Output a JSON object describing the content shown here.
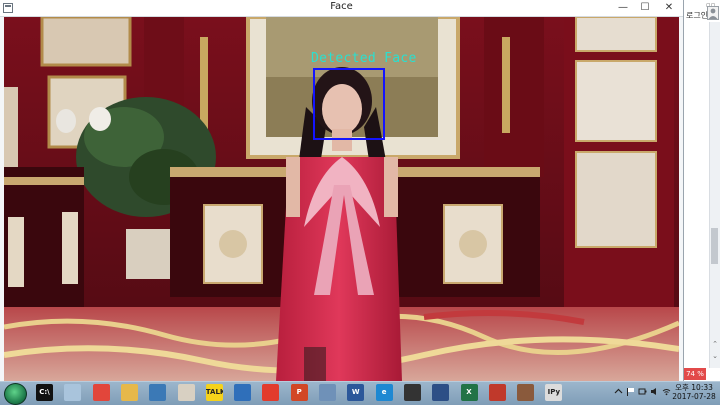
{
  "window": {
    "title": "Face",
    "min_glyph": "—",
    "max_glyph": "☐",
    "close_glyph": "✕"
  },
  "detection": {
    "label": "Detected Face",
    "box_color": "#1414ff",
    "label_color": "#29e0d0"
  },
  "browser_panel": {
    "login_label": "로그인",
    "zoom": "74 %",
    "scroll_up_glyph": "⌃",
    "scroll_down_glyph": "⌄"
  },
  "taskbar": {
    "pinned": [
      {
        "name": "cmd-icon",
        "glyph": "C:\\",
        "color": "#111111"
      },
      {
        "name": "file-icon",
        "glyph": "",
        "color": "#a9c4dc"
      },
      {
        "name": "chrome-icon",
        "glyph": "",
        "color": "#e2463b"
      },
      {
        "name": "explorer-icon",
        "glyph": "",
        "color": "#e6b84a"
      },
      {
        "name": "python-icon",
        "glyph": "",
        "color": "#3b79b6"
      },
      {
        "name": "paint-icon",
        "glyph": "",
        "color": "#d8d0c2"
      },
      {
        "name": "kakaotalk-icon",
        "glyph": "TALK",
        "color": "#f5d21b"
      },
      {
        "name": "hwp-icon",
        "glyph": "",
        "color": "#2f6fba"
      },
      {
        "name": "daum-icon",
        "glyph": "",
        "color": "#e23b2c"
      },
      {
        "name": "powerpoint-icon",
        "glyph": "P",
        "color": "#d24726"
      },
      {
        "name": "document-icon",
        "glyph": "",
        "color": "#6f91b8"
      },
      {
        "name": "word-icon",
        "glyph": "W",
        "color": "#2b579a"
      },
      {
        "name": "internet-explorer-icon",
        "glyph": "e",
        "color": "#1e88d2"
      },
      {
        "name": "media-icon",
        "glyph": "",
        "color": "#333333"
      },
      {
        "name": "settings-icon",
        "glyph": "",
        "color": "#2d4f86"
      },
      {
        "name": "excel-icon",
        "glyph": "X",
        "color": "#217346"
      },
      {
        "name": "matlab-icon",
        "glyph": "",
        "color": "#c0392b"
      },
      {
        "name": "photo-icon",
        "glyph": "",
        "color": "#8a5a3c"
      },
      {
        "name": "ipython-icon",
        "glyph": "IPy",
        "color": "#dcdcdc"
      }
    ],
    "clock_time": "오후 10:33",
    "clock_date": "2017-07-28"
  }
}
